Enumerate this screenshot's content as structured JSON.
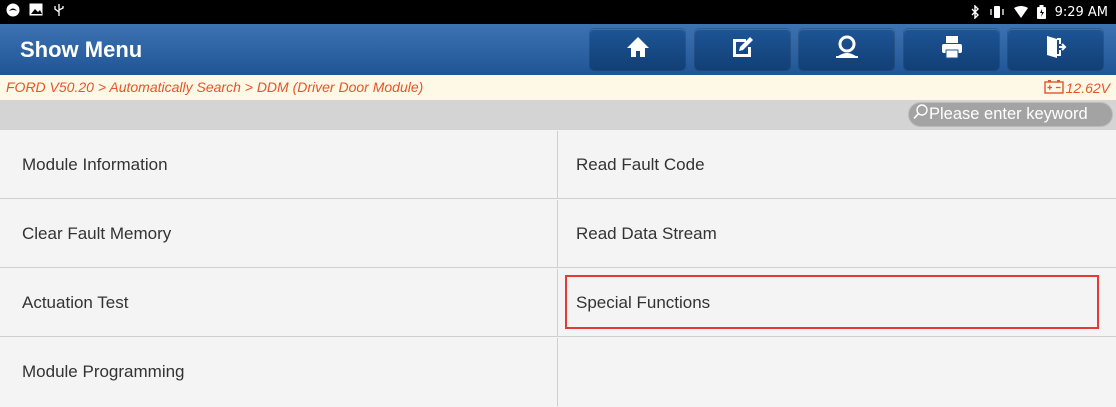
{
  "status_bar": {
    "time": "9:29 AM",
    "icons_left": [
      "app-icon",
      "image-icon",
      "usb-icon"
    ],
    "icons_right": [
      "bluetooth-icon",
      "vibrate-icon",
      "wifi-icon",
      "battery-icon"
    ]
  },
  "header": {
    "title": "Show Menu",
    "buttons": [
      "home-icon",
      "report-icon",
      "user-icon",
      "print-icon",
      "exit-icon"
    ],
    "color": "#2a64a6"
  },
  "breadcrumb": {
    "path": "FORD V50.20 > Automatically Search > DDM (Driver Door Module)",
    "voltage": "12.62V",
    "color": "#e8532b"
  },
  "search": {
    "placeholder": "Please enter keyword"
  },
  "menu": {
    "items": [
      "Module Information",
      "Read Fault Code",
      "Clear Fault Memory",
      "Read Data Stream",
      "Actuation Test",
      "Special Functions",
      "Module Programming",
      ""
    ],
    "highlighted": "Special Functions",
    "highlight_color": "#e53935"
  }
}
